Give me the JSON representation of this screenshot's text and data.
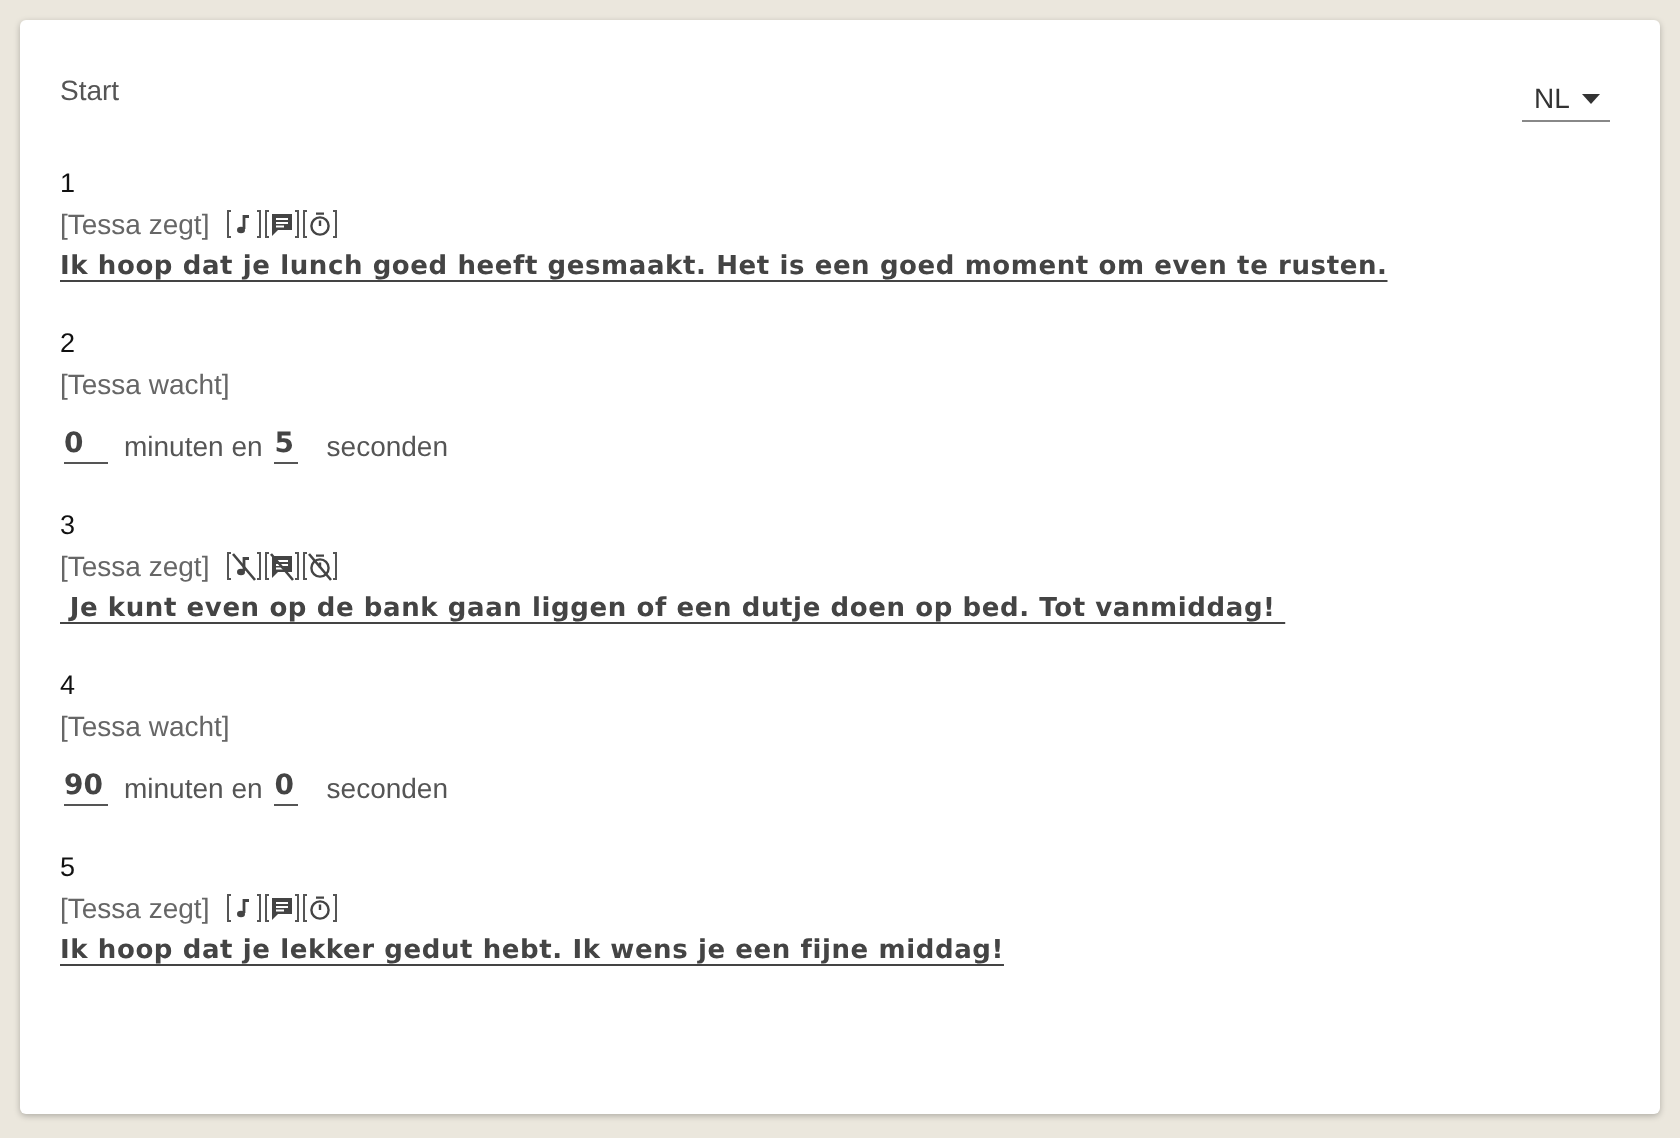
{
  "header": {
    "title": "Start",
    "language": "NL"
  },
  "steps": [
    {
      "kind": "say",
      "number": "1",
      "label": "[Tessa zegt]",
      "toggles": [
        {
          "kind": "music",
          "on": true
        },
        {
          "kind": "chat",
          "on": true
        },
        {
          "kind": "timer",
          "on": true
        }
      ],
      "text": "Ik hoop dat je lunch goed heeft gesmaakt. Het is een goed moment om even te rusten."
    },
    {
      "kind": "wait",
      "number": "2",
      "label": "[Tessa wacht]",
      "minutes": "0",
      "minutes_label": "minuten en",
      "seconds": "5",
      "seconds_label": "seconden"
    },
    {
      "kind": "say",
      "number": "3",
      "label": "[Tessa zegt]",
      "toggles": [
        {
          "kind": "music",
          "on": false
        },
        {
          "kind": "chat",
          "on": false
        },
        {
          "kind": "timer",
          "on": false
        }
      ],
      "text": " Je kunt even op de bank gaan liggen of een dutje doen op bed. Tot vanmiddag! "
    },
    {
      "kind": "wait",
      "number": "4",
      "label": "[Tessa wacht]",
      "minutes": "90",
      "minutes_label": "minuten en",
      "seconds": "0",
      "seconds_label": "seconden"
    },
    {
      "kind": "say",
      "number": "5",
      "label": "[Tessa zegt]",
      "toggles": [
        {
          "kind": "music",
          "on": true
        },
        {
          "kind": "chat",
          "on": true
        },
        {
          "kind": "timer",
          "on": true
        }
      ],
      "text": "Ik hoop dat je lekker gedut hebt. Ik wens je een fijne middag!"
    }
  ]
}
